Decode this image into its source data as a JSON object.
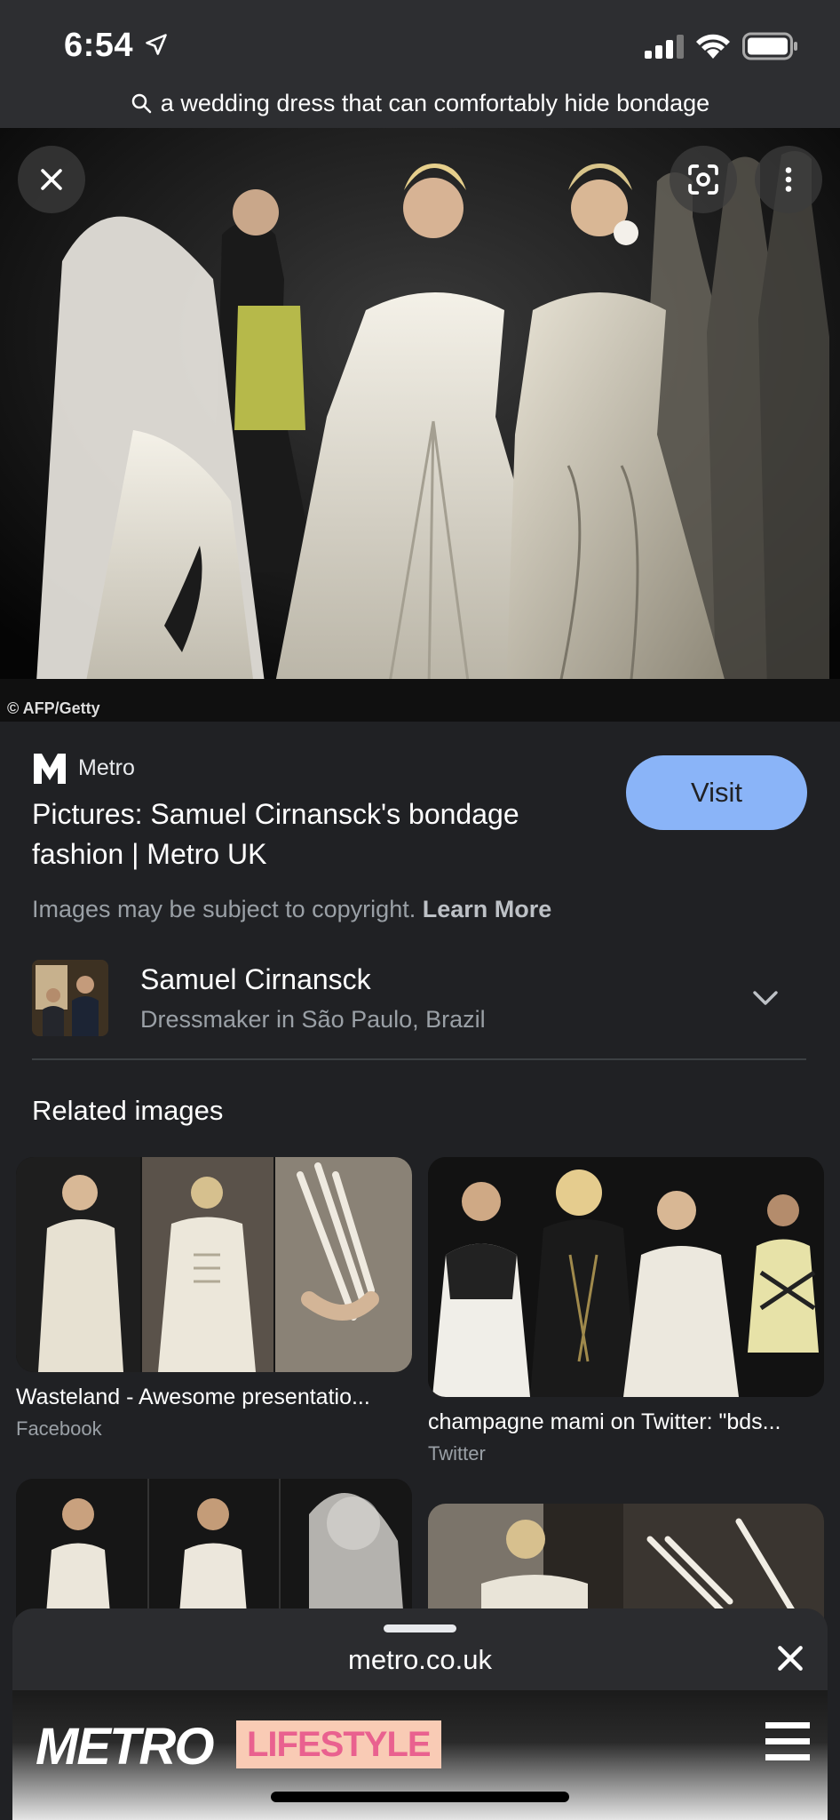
{
  "status_bar": {
    "time": "6:54"
  },
  "search": {
    "query": "a wedding dress that can comfortably hide bondage"
  },
  "hero": {
    "credit": "© AFP/Getty"
  },
  "result": {
    "source_name": "Metro",
    "title": "Pictures: Samuel Cirnansck's bondage fashion | Metro UK",
    "visit_label": "Visit",
    "copyright_text": "Images may be subject to copyright.",
    "learn_more_label": "Learn More"
  },
  "knowledge_panel": {
    "name": "Samuel Cirnansck",
    "description": "Dressmaker in São Paulo, Brazil"
  },
  "related": {
    "heading": "Related images",
    "items": [
      {
        "title": "Wasteland - Awesome presentatio...",
        "source": "Facebook"
      },
      {
        "title": "champagne mami on Twitter: \"bds...",
        "source": "Twitter"
      },
      {
        "title": "",
        "source": ""
      },
      {
        "title": "",
        "source": ""
      }
    ]
  },
  "sheet": {
    "domain": "metro.co.uk",
    "site_logo": "METRO",
    "site_section": "LIFESTYLE"
  },
  "colors": {
    "background": "#202124",
    "visit_button": "#8ab4f8",
    "lifestyle_badge_bg": "#f9cbb5",
    "lifestyle_badge_text": "#e9618f"
  },
  "icons": [
    "location-arrow-icon",
    "signal-icon",
    "wifi-icon",
    "battery-icon",
    "search-icon",
    "close-icon",
    "lens-icon",
    "more-vert-icon",
    "chevron-down-icon",
    "menu-icon"
  ]
}
